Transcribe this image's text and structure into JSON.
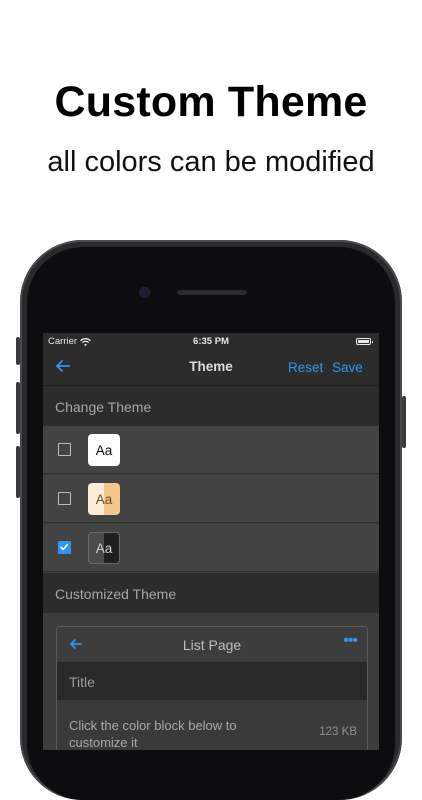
{
  "headline": "Custom Theme",
  "subline": "all colors can be modified",
  "status_bar": {
    "carrier": "Carrier",
    "time": "6:35 PM"
  },
  "navbar": {
    "title": "Theme",
    "reset": "Reset",
    "save": "Save"
  },
  "sections": {
    "change_theme": "Change Theme",
    "customized_theme": "Customized Theme"
  },
  "themes": [
    {
      "sample": "Aa",
      "checked": false
    },
    {
      "sample": "Aa",
      "checked": false
    },
    {
      "sample": "Aa",
      "checked": true
    }
  ],
  "preview": {
    "title": "List Page",
    "more": "•••",
    "title_bar": "Title",
    "item_text": "Click the color block below to customize it",
    "item_size": "123 KB"
  },
  "colors": {
    "accent": "#2f95f0",
    "screen_bg": "#3d3d3d",
    "header_bg": "#2c2c2c"
  },
  "icons": [
    "back-arrow-icon",
    "wifi-icon",
    "battery-icon",
    "checkmark-icon",
    "more-icon"
  ]
}
